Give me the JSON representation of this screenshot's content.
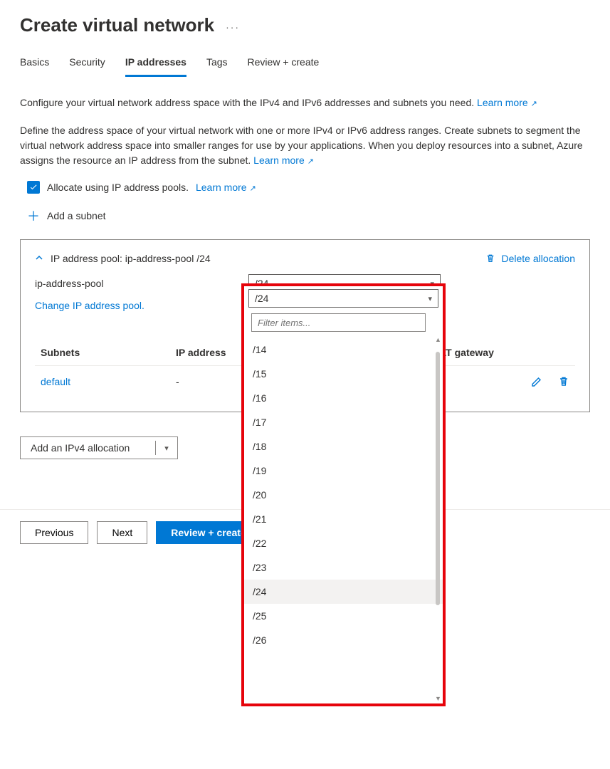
{
  "header": {
    "title": "Create virtual network"
  },
  "tabs": [
    {
      "label": "Basics"
    },
    {
      "label": "Security"
    },
    {
      "label": "IP addresses",
      "active": true
    },
    {
      "label": "Tags"
    },
    {
      "label": "Review + create"
    }
  ],
  "intro": {
    "line1": "Configure your virtual network address space with the IPv4 and IPv6 addresses and subnets you need. ",
    "learn1": "Learn more",
    "line2a": "Define the address space of your virtual network with one or more IPv4 or IPv6 address ranges. Create subnets to segment the virtual network address space into smaller ranges for use by your applications. When you deploy resources into a subnet, Azure assigns the resource an IP address from the subnet. ",
    "learn2": "Learn more"
  },
  "allocate": {
    "checkbox_label": "Allocate using IP address pools.",
    "learn": "Learn more"
  },
  "add_subnet_label": "Add a subnet",
  "panel": {
    "title": "IP address pool: ip-address-pool /24",
    "delete_label": "Delete allocation",
    "pool_name": "ip-address-pool",
    "cidr_display": "/24",
    "change_link": "Change IP address pool.",
    "table": {
      "col_subnets": "Subnets",
      "col_ip": "IP address",
      "col_nat": "NAT gateway",
      "row": {
        "name": "default",
        "ip": "-",
        "nat": ""
      }
    }
  },
  "add_alloc_label": "Add an IPv4 allocation",
  "dropdown": {
    "selected": "/24",
    "filter_placeholder": "Filter items...",
    "options": [
      "/14",
      "/15",
      "/16",
      "/17",
      "/18",
      "/19",
      "/20",
      "/21",
      "/22",
      "/23",
      "/24",
      "/25",
      "/26"
    ],
    "selected_index": 10
  },
  "footer": {
    "previous": "Previous",
    "next": "Next",
    "review": "Review + create"
  }
}
